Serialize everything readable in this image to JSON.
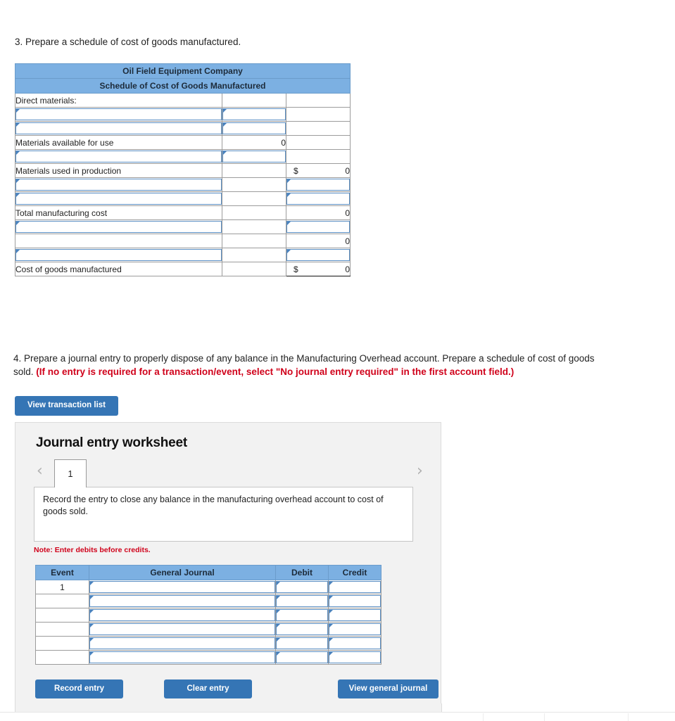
{
  "questions": {
    "q3": "3. Prepare a schedule of cost of goods manufactured.",
    "q4_main": "4. Prepare a journal entry to properly dispose of any balance in the Manufacturing Overhead account. Prepare a schedule of cost of goods sold. ",
    "q4_red": "(If no entry is required for a transaction/event, select \"No journal entry required\" in the first account field.)"
  },
  "cogm": {
    "company": "Oil Field Equipment Company",
    "subtitle": "Schedule of Cost of Goods Manufactured",
    "rows": [
      {
        "type": "label",
        "label": "Direct materials:",
        "indent": false,
        "col2": "",
        "col3": ""
      },
      {
        "type": "input2",
        "label": "",
        "indent": false
      },
      {
        "type": "input2",
        "label": "",
        "indent": false
      },
      {
        "type": "value2",
        "label": "Materials available for use",
        "indent": true,
        "col2": "0",
        "col3": ""
      },
      {
        "type": "input2",
        "label": "",
        "indent": false
      },
      {
        "type": "value3d",
        "label": "Materials used in production",
        "indent": true,
        "col2": "",
        "col3": "0",
        "dollar": "$"
      },
      {
        "type": "input3",
        "label": "",
        "indent": false
      },
      {
        "type": "input3",
        "label": "",
        "indent": false
      },
      {
        "type": "value3",
        "label": "Total manufacturing cost",
        "indent": false,
        "col2": "",
        "col3": "0"
      },
      {
        "type": "input3",
        "label": "",
        "indent": false
      },
      {
        "type": "value3",
        "label": "",
        "indent": false,
        "col2": "",
        "col3": "0"
      },
      {
        "type": "input3",
        "label": "",
        "indent": false
      },
      {
        "type": "value3d",
        "label": "Cost of goods manufactured",
        "indent": false,
        "col2": "",
        "col3": "0",
        "dollar": "$"
      }
    ]
  },
  "buttons": {
    "view_transaction_list": "View transaction list",
    "record_entry": "Record entry",
    "clear_entry": "Clear entry",
    "view_general_journal": "View general journal"
  },
  "journal": {
    "title": "Journal entry worksheet",
    "pager": {
      "prev": "‹",
      "next": "›",
      "current": "1"
    },
    "description": "Record the entry to close any balance in the manufacturing overhead account to cost of goods sold.",
    "note": "Note: Enter debits before credits.",
    "columns": [
      "Event",
      "General Journal",
      "Debit",
      "Credit"
    ],
    "rows": [
      {
        "event": "1",
        "account": "",
        "debit": "",
        "credit": ""
      },
      {
        "event": "",
        "account": "",
        "debit": "",
        "credit": ""
      },
      {
        "event": "",
        "account": "",
        "debit": "",
        "credit": ""
      },
      {
        "event": "",
        "account": "",
        "debit": "",
        "credit": ""
      },
      {
        "event": "",
        "account": "",
        "debit": "",
        "credit": ""
      },
      {
        "event": "",
        "account": "",
        "debit": "",
        "credit": ""
      }
    ]
  },
  "colors": {
    "table_header_blue": "#7cb0e2",
    "button_blue": "#3575b5",
    "alert_red": "#d0021b",
    "input_border_blue": "#5b8fc4",
    "panel_gray": "#f2f2f2"
  }
}
